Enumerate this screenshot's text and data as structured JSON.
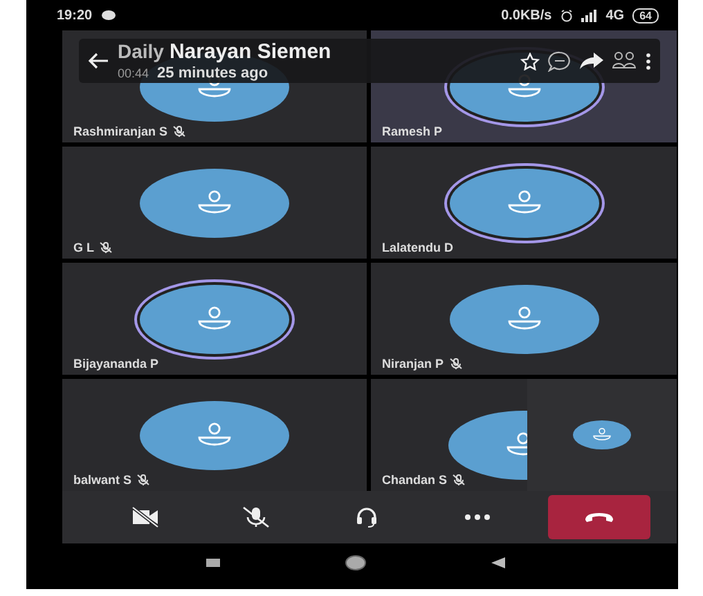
{
  "status_bar": {
    "time": "19:20",
    "net_speed": "0.0KB/s",
    "network": "4G",
    "battery": "64"
  },
  "header": {
    "title": "Daily",
    "speaker": "Narayan Siemen",
    "duration": "00:44",
    "speaker_time": "25 minutes ago"
  },
  "participants": [
    {
      "name": "Rashmiranjan S",
      "muted": true,
      "speaking": false,
      "active": false
    },
    {
      "name": "Ramesh P",
      "muted": false,
      "speaking": true,
      "active": true
    },
    {
      "name": "G L",
      "muted": true,
      "speaking": false,
      "active": false
    },
    {
      "name": "Lalatendu D",
      "muted": false,
      "speaking": true,
      "active": false
    },
    {
      "name": "Bijayananda P",
      "muted": false,
      "speaking": true,
      "active": false
    },
    {
      "name": "Niranjan P",
      "muted": true,
      "speaking": false,
      "active": false
    },
    {
      "name": "balwant S",
      "muted": true,
      "speaking": false,
      "active": false
    },
    {
      "name": "Chandan S",
      "muted": true,
      "speaking": false,
      "active": false
    }
  ],
  "controls": [
    {
      "kind": "camera",
      "on": false
    },
    {
      "kind": "mic",
      "on": false
    },
    {
      "kind": "audio"
    },
    {
      "kind": "more"
    },
    {
      "kind": "hangup"
    }
  ]
}
